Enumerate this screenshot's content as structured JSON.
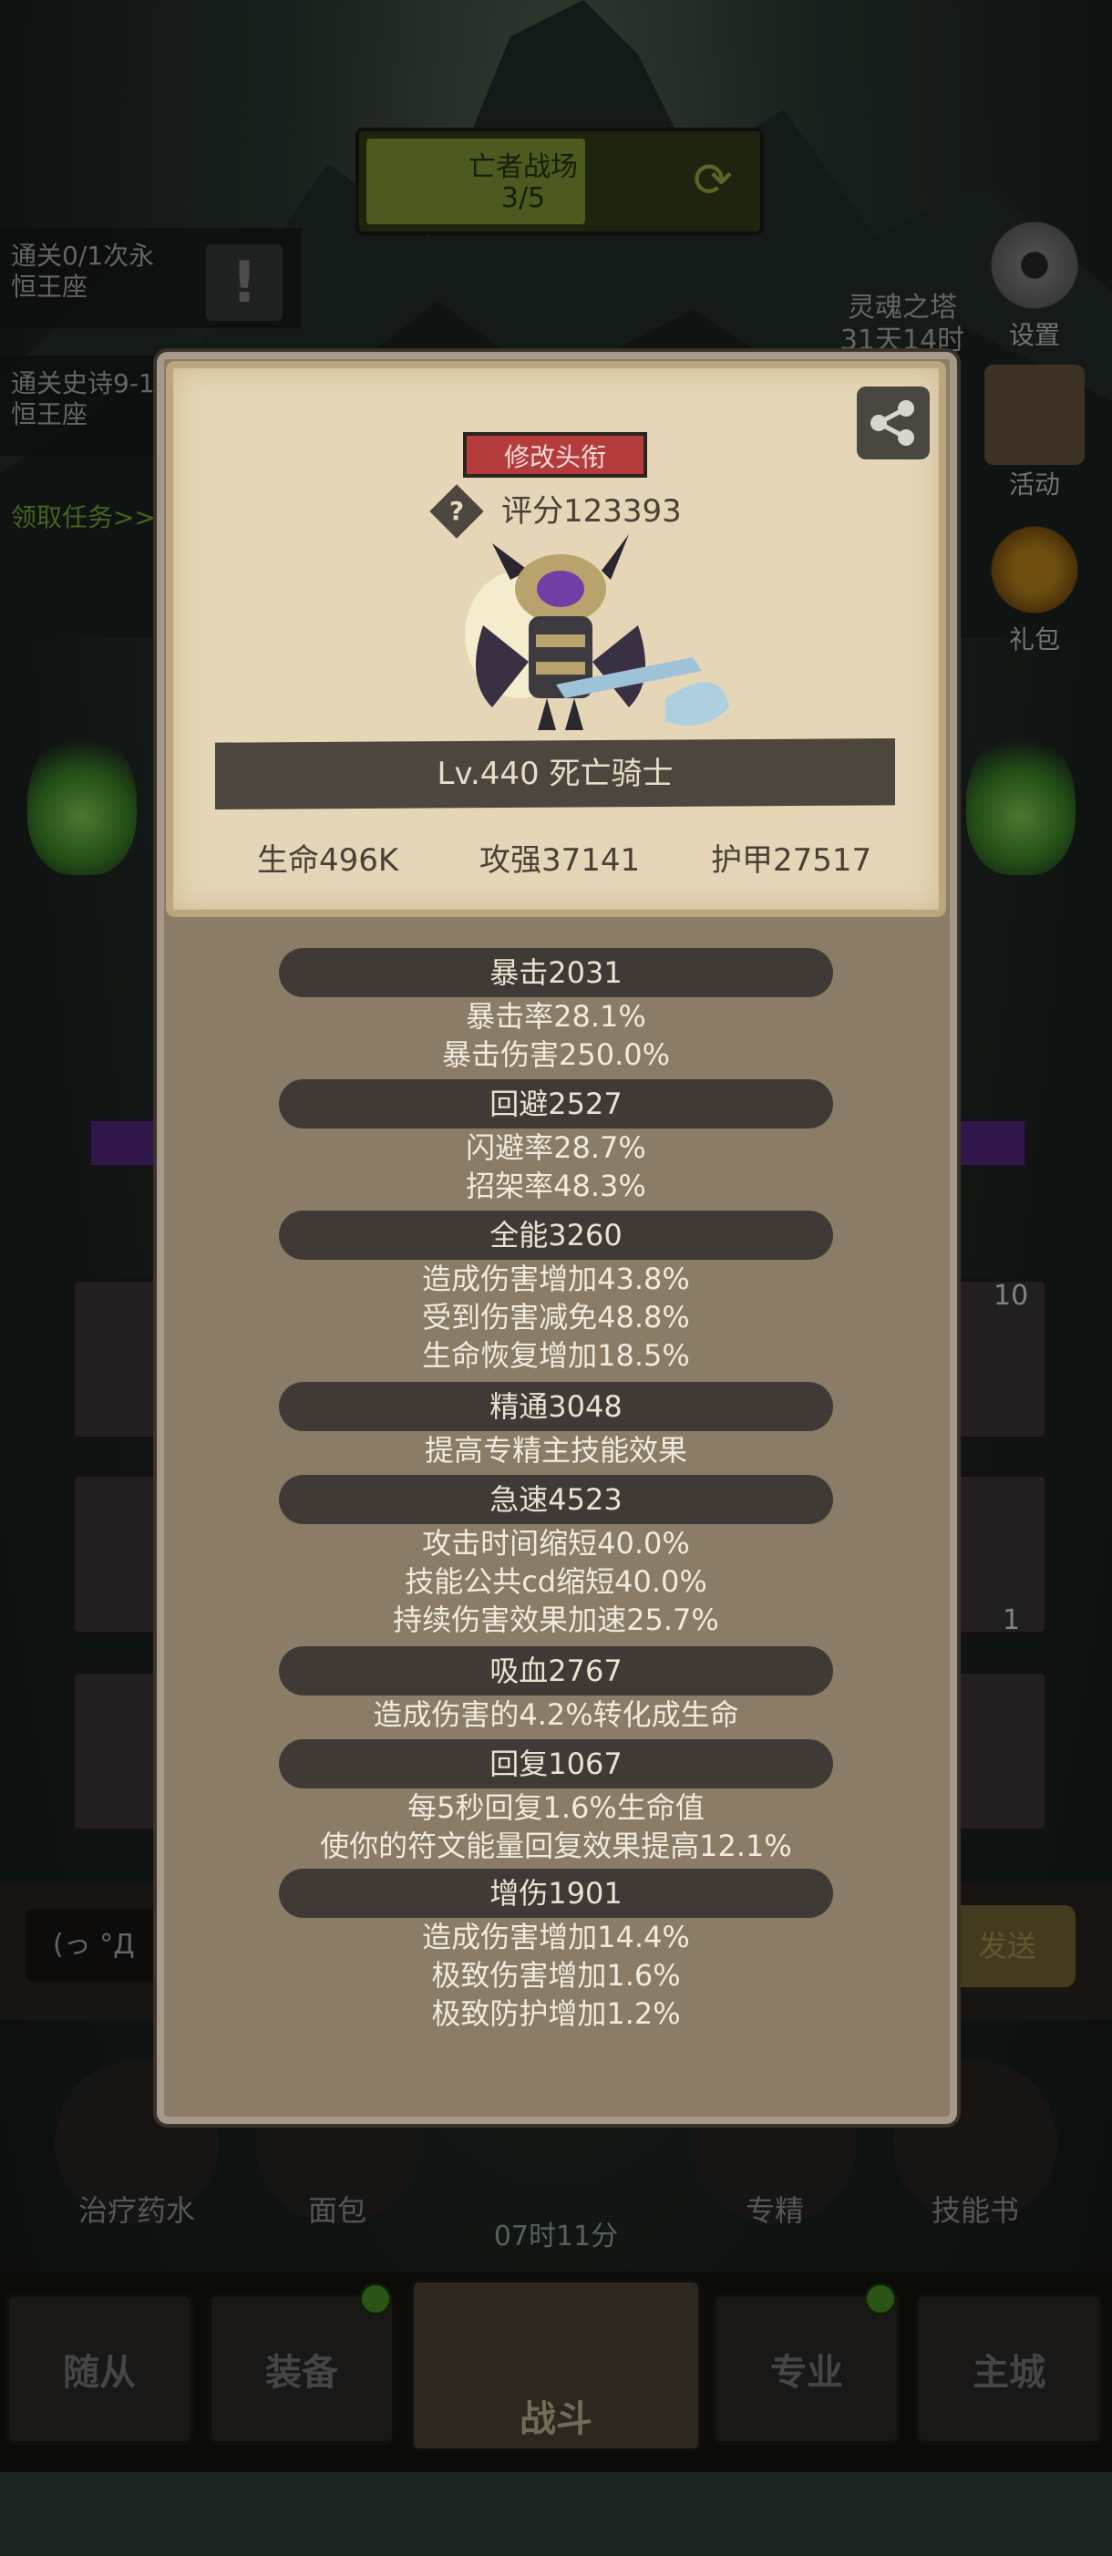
{
  "banner": {
    "title": "亡者战场",
    "count": "3/5"
  },
  "quests": [
    {
      "line1": "通关0/1次永",
      "line2": "恒王座"
    },
    {
      "line1": "通关史诗9-1",
      "line2": "恒王座"
    }
  ],
  "quest_link": "领取任务>>",
  "side": {
    "tower_name": "灵魂之塔",
    "tower_time": "31天14时",
    "settings": "设置",
    "activity": "活动",
    "gift": "礼包"
  },
  "slot_badges": {
    "top": "10",
    "mid": "1"
  },
  "chat": {
    "emoticon": "(っ °Д",
    "send": "发送"
  },
  "potions": {
    "heal": "治疗药水",
    "bread": "面包",
    "spec": "专精",
    "skillbook": "技能书",
    "timer": "07时11分"
  },
  "nav": {
    "follower": "随从",
    "equip": "装备",
    "battle": "战斗",
    "profession": "专业",
    "city": "主城"
  },
  "card": {
    "title_button": "修改头衔",
    "help_mark": "?",
    "score": "评分123393",
    "name": "Lv.440 死亡骑士",
    "hp": "生命496K",
    "attack": "攻强37141",
    "armor": "护甲27517"
  },
  "stats": [
    {
      "name": "暴击2031",
      "lines": [
        "暴击率28.1%",
        "暴击伤害250.0%"
      ]
    },
    {
      "name": "回避2527",
      "lines": [
        "闪避率28.7%",
        "招架率48.3%"
      ]
    },
    {
      "name": "全能3260",
      "lines": [
        "造成伤害增加43.8%",
        "受到伤害减免48.8%",
        "生命恢复增加18.5%"
      ]
    },
    {
      "name": "精通3048",
      "lines": [
        "提高专精主技能效果"
      ]
    },
    {
      "name": "急速4523",
      "lines": [
        "攻击时间缩短40.0%",
        "技能公共cd缩短40.0%",
        "持续伤害效果加速25.7%"
      ]
    },
    {
      "name": "吸血2767",
      "lines": [
        "造成伤害的4.2%转化成生命"
      ]
    },
    {
      "name": "回复1067",
      "lines": [
        "每5秒回复1.6%生命值",
        "使你的符文能量回复效果提高12.1%"
      ]
    },
    {
      "name": "增伤1901",
      "lines": [
        "造成伤害增加14.4%",
        "极致伤害增加1.6%",
        "极致防护增加1.2%"
      ]
    }
  ]
}
